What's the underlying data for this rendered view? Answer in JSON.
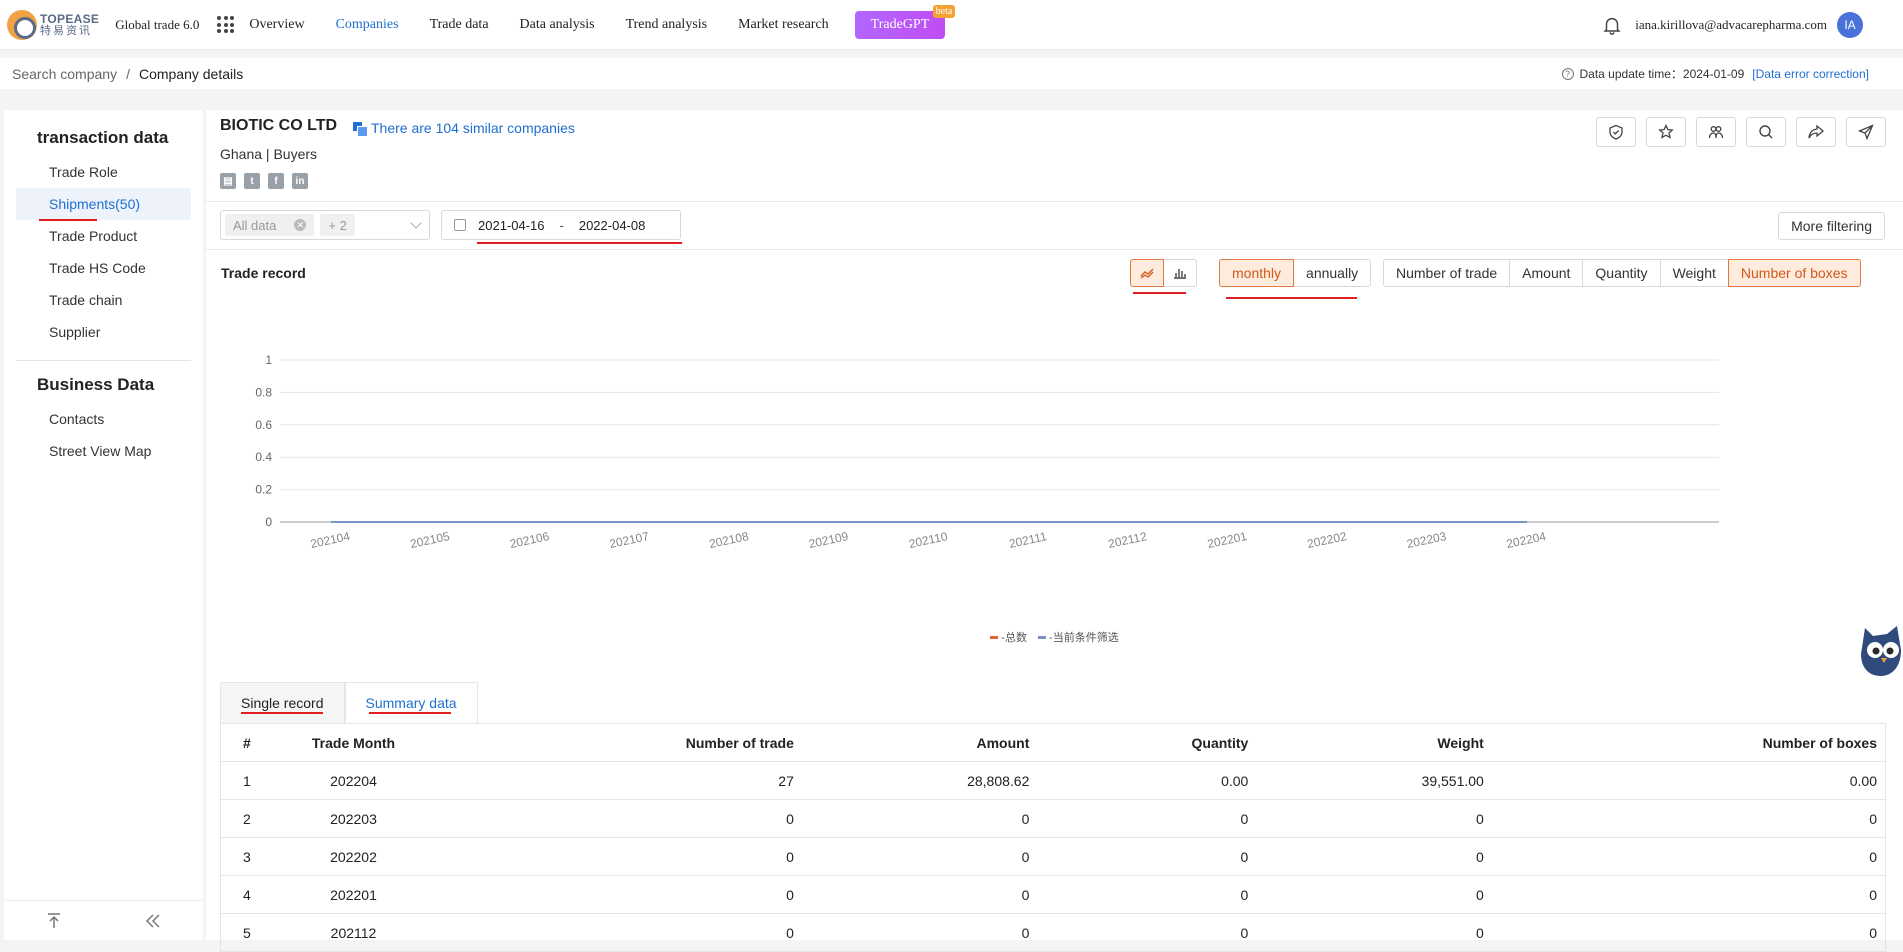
{
  "header": {
    "logo_line1": "TOPEASE",
    "logo_line2": "特易资讯",
    "product": "Global trade 6.0",
    "nav": [
      {
        "label": "Overview"
      },
      {
        "label": "Companies",
        "active": true
      },
      {
        "label": "Trade data"
      },
      {
        "label": "Data analysis"
      },
      {
        "label": "Trend analysis"
      },
      {
        "label": "Market research"
      }
    ],
    "tradegpt": "TradeGPT",
    "beta": "beta",
    "email": "iana.kirillova@advacarepharma.com",
    "avatar": "IA"
  },
  "breadcrumb": {
    "root": "Search company",
    "sep": "/",
    "current": "Company details",
    "update_label": "Data update time：2024-01-09",
    "error_link": "[Data error correction]"
  },
  "sidebar": {
    "section1": "transaction data",
    "items1": [
      "Trade Role",
      "Shipments(50)",
      "Trade Product",
      "Trade HS Code",
      "Trade chain",
      "Supplier"
    ],
    "section2": "Business Data",
    "items2": [
      "Contacts",
      "Street View Map"
    ]
  },
  "company": {
    "name": "BIOTIC CO LTD",
    "similar": "There are 104 similar companies",
    "sub": "Ghana | Buyers"
  },
  "filters": {
    "tag": "All data",
    "more_tag": "+ 2",
    "date_start": "2021-04-16",
    "date_sep": "-",
    "date_end": "2022-04-08",
    "more_filtering": "More filtering"
  },
  "trade_record": {
    "title": "Trade record",
    "period": [
      "monthly",
      "annually"
    ],
    "metrics": [
      "Number of trade",
      "Amount",
      "Quantity",
      "Weight",
      "Number of boxes"
    ]
  },
  "colors": {
    "accent": "#d2581c",
    "link": "#1f6fd0",
    "series_total": "#e8603c",
    "series_filter": "#7b93c7"
  },
  "chart_data": {
    "type": "line",
    "x": [
      "202104",
      "202105",
      "202106",
      "202107",
      "202108",
      "202109",
      "202110",
      "202111",
      "202112",
      "202201",
      "202202",
      "202203",
      "202204"
    ],
    "series": [
      {
        "name": "-总数",
        "values": [
          0,
          0,
          0,
          0,
          0,
          0,
          0,
          0,
          0,
          0,
          0,
          0,
          0
        ]
      },
      {
        "name": "-当前条件筛选",
        "values": [
          0,
          0,
          0,
          0,
          0,
          0,
          0,
          0,
          0,
          0,
          0,
          0,
          0
        ]
      }
    ],
    "yticks": [
      "0",
      "0.2",
      "0.4",
      "0.6",
      "0.8",
      "1"
    ],
    "ylim": [
      0,
      1
    ],
    "grid": true,
    "legend": "bottom-center"
  },
  "table": {
    "tabs": [
      "Single record",
      "Summary data"
    ],
    "headers": [
      "#",
      "Trade Month",
      "Number of trade",
      "Amount",
      "Quantity",
      "Weight",
      "Number of boxes"
    ],
    "rows": [
      [
        "1",
        "202204",
        "27",
        "28,808.62",
        "0.00",
        "39,551.00",
        "0.00"
      ],
      [
        "2",
        "202203",
        "0",
        "0",
        "0",
        "0",
        "0"
      ],
      [
        "3",
        "202202",
        "0",
        "0",
        "0",
        "0",
        "0"
      ],
      [
        "4",
        "202201",
        "0",
        "0",
        "0",
        "0",
        "0"
      ],
      [
        "5",
        "202112",
        "0",
        "0",
        "0",
        "0",
        "0"
      ]
    ]
  }
}
